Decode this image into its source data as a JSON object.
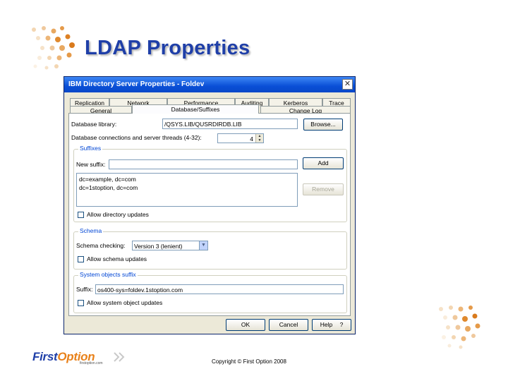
{
  "slide": {
    "title": "LDAP Properties",
    "copyright": "Copyright © First Option 2008"
  },
  "logo": {
    "first": "First",
    "option": "Option",
    "sub": "firstoption.com"
  },
  "dialog": {
    "title": "IBM Directory Server Properties - Foldev",
    "close_glyph": "✕",
    "tabs_back": [
      "Replication",
      "Network",
      "Performance",
      "Auditing",
      "Kerberos",
      "Trace"
    ],
    "tabs_front": [
      "General",
      "Database/Suffixes",
      "Change Log"
    ],
    "active_tab": "Database/Suffixes",
    "database_library_label": "Database library:",
    "database_library_value": "/QSYS.LIB/QUSRDIRDB.LIB",
    "browse_label": "Browse...",
    "connections_label": "Database connections and server threads (4-32):",
    "connections_value": "4",
    "suffixes_group": "Suffixes",
    "new_suffix_label": "New suffix:",
    "new_suffix_value": "",
    "add_label": "Add",
    "remove_label": "Remove",
    "suffix_list": [
      "dc=example, dc=com",
      "dc=1stoption, dc=com"
    ],
    "allow_directory_updates": "Allow directory updates",
    "schema_group": "Schema",
    "schema_checking_label": "Schema checking:",
    "schema_checking_value": "Version 3 (lenient)",
    "allow_schema_updates": "Allow schema updates",
    "system_objects_group": "System objects suffix",
    "suffix_label": "Suffix:",
    "suffix_value": "os400-sys=foldev.1stoption.com",
    "allow_system_object_updates": "Allow system object updates",
    "ok_label": "OK",
    "cancel_label": "Cancel",
    "help_label": "Help",
    "help_glyph": "?"
  }
}
